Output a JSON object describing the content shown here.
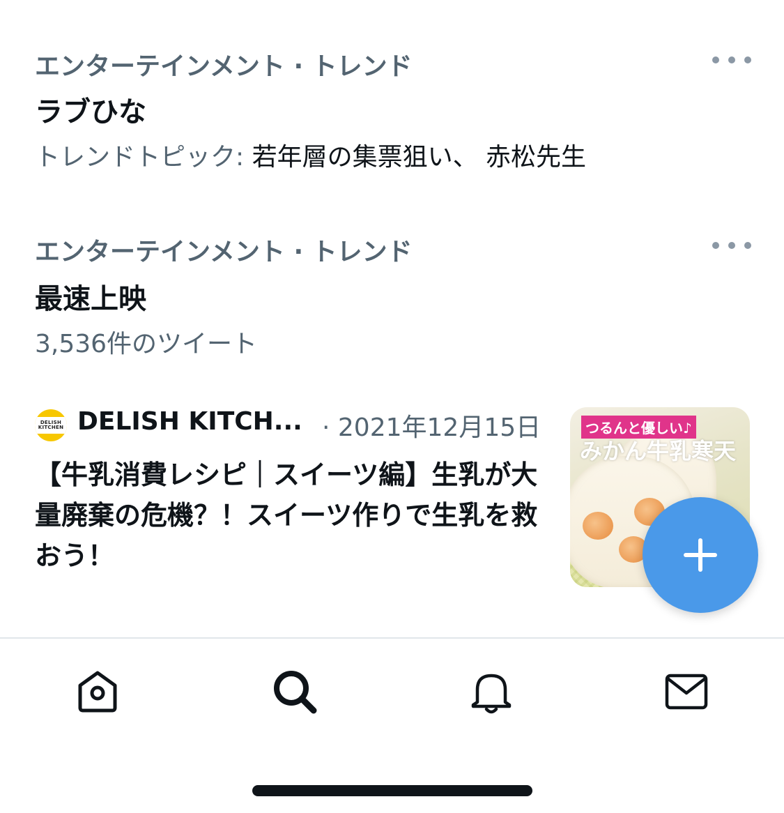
{
  "trends": [
    {
      "category": "エンターテインメント · トレンド",
      "name": "ラブひな",
      "sub_prefix": "トレンドトピック: ",
      "sub_topics": "若年層の集票狙い、 赤松先生"
    },
    {
      "category": "エンターテインメント · トレンド",
      "name": "最速上映",
      "tweet_count": "3,536件のツイート"
    }
  ],
  "news": {
    "source": "DELISH KITCH...",
    "date": "· 2021年12月15日",
    "avatar_line1": "DELISH",
    "avatar_line2": "KITCHEN",
    "headline": "【牛乳消費レシピ｜スイーツ編】生乳が大量廃棄の危機？！スイーツ作りで生乳を救おう！",
    "thumb_tag": "つるんと優しい♪",
    "thumb_title": "みかん牛乳寒天"
  },
  "icons": {
    "more": "more-dots-icon",
    "fab": "plus-icon",
    "home": "home-icon",
    "search": "search-icon",
    "notifications": "bell-icon",
    "messages": "mail-icon"
  },
  "colors": {
    "accent": "#4a99e9",
    "secondary_text": "#536471",
    "primary_text": "#0f1419"
  }
}
